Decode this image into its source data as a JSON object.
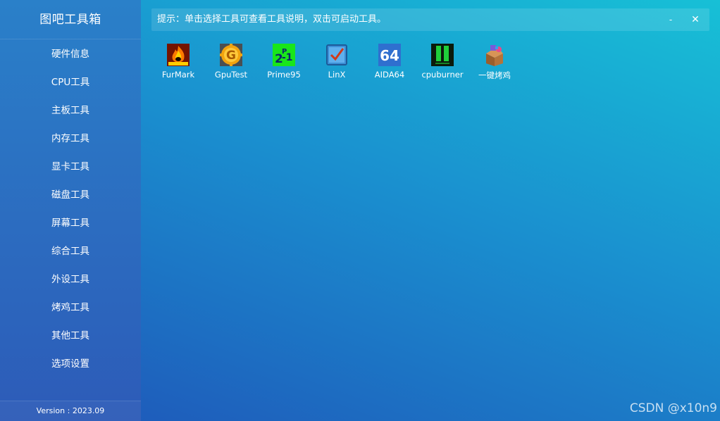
{
  "sidebar": {
    "app_title": "图吧工具箱",
    "items": [
      {
        "label": "硬件信息"
      },
      {
        "label": "CPU工具"
      },
      {
        "label": "主板工具"
      },
      {
        "label": "内存工具"
      },
      {
        "label": "显卡工具"
      },
      {
        "label": "磁盘工具"
      },
      {
        "label": "屏幕工具"
      },
      {
        "label": "综合工具"
      },
      {
        "label": "外设工具"
      },
      {
        "label": "烤鸡工具"
      },
      {
        "label": "其他工具"
      },
      {
        "label": "选项设置"
      }
    ],
    "version": "Version : 2023.09"
  },
  "header": {
    "hint": "提示：单击选择工具可查看工具说明，双击可启动工具。",
    "minimize_label": "-",
    "close_label": "✕"
  },
  "tools": [
    {
      "label": "FurMark",
      "icon": "furmark-icon"
    },
    {
      "label": "GpuTest",
      "icon": "gputest-icon"
    },
    {
      "label": "Prime95",
      "icon": "prime95-icon"
    },
    {
      "label": "LinX",
      "icon": "linx-icon"
    },
    {
      "label": "AIDA64",
      "icon": "aida64-icon",
      "icon_text": "64"
    },
    {
      "label": "cpuburner",
      "icon": "cpuburner-icon"
    },
    {
      "label": "一键烤鸡",
      "icon": "package-icon"
    }
  ],
  "watermark": "CSDN @x10n9",
  "colors": {
    "sidebar_top": "#2a80c9",
    "sidebar_bottom": "#2d5bb8",
    "main_top": "#17c0d6",
    "main_bottom": "#1f55b8"
  }
}
